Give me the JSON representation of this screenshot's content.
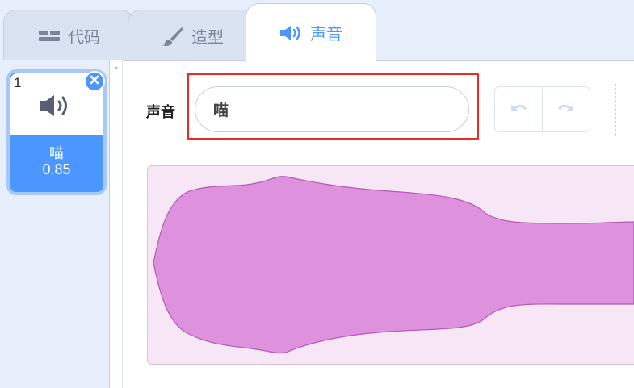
{
  "tabs": {
    "code": {
      "label": "代码",
      "icon": "code-blocks-icon"
    },
    "costume": {
      "label": "造型",
      "icon": "paintbrush-icon"
    },
    "sound": {
      "label": "声音",
      "icon": "speaker-icon",
      "selected": true
    }
  },
  "sound_list": {
    "items": [
      {
        "index": "1",
        "name": "喵",
        "duration": "0.85",
        "icon": "speaker-icon",
        "selected": true
      }
    ]
  },
  "editor": {
    "name_label": "声音",
    "name_value": "喵",
    "undo_icon": "undo-icon",
    "redo_icon": "redo-icon"
  },
  "colors": {
    "accent": "#4c97ff",
    "highlight_box": "#ec2a2a",
    "waveform_fill": "#de92de",
    "waveform_stroke": "#b45ab4",
    "waveform_bg": "#f6e6f6"
  }
}
